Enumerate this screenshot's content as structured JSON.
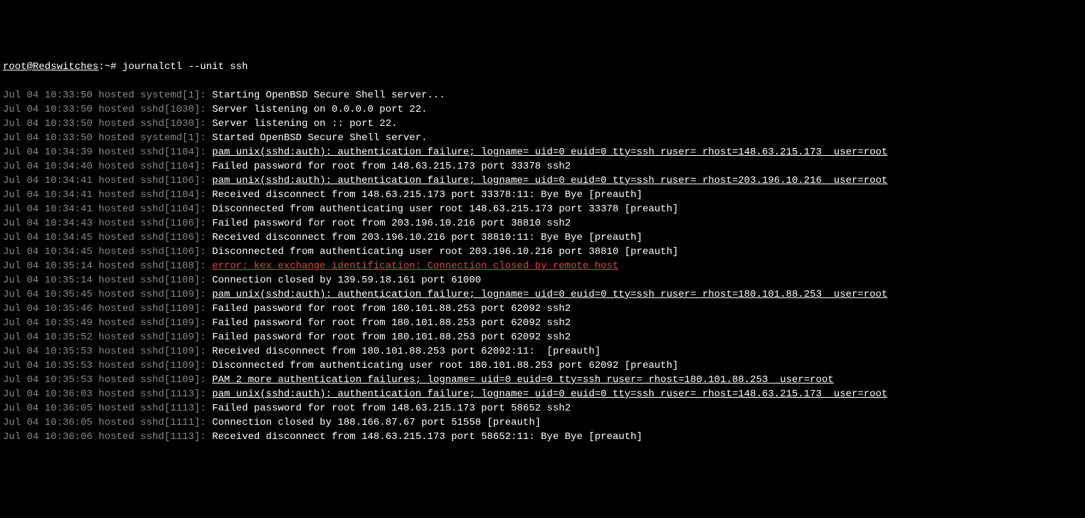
{
  "prompt": {
    "user_host": "root@Redswitches",
    "separator": ":~# ",
    "command": "journalctl --unit ssh"
  },
  "logs": [
    {
      "ts": "Jul 04 10:33:50",
      "host": "hosted",
      "proc": "systemd[1]",
      "msg": "Starting OpenBSD Secure Shell server...",
      "style": "plain"
    },
    {
      "ts": "Jul 04 10:33:50",
      "host": "hosted",
      "proc": "sshd[1030]",
      "msg": "Server listening on 0.0.0.0 port 22.",
      "style": "plain"
    },
    {
      "ts": "Jul 04 10:33:50",
      "host": "hosted",
      "proc": "sshd[1030]",
      "msg": "Server listening on :: port 22.",
      "style": "plain"
    },
    {
      "ts": "Jul 04 10:33:50",
      "host": "hosted",
      "proc": "systemd[1]",
      "msg": "Started OpenBSD Secure Shell server.",
      "style": "plain"
    },
    {
      "ts": "Jul 04 10:34:39",
      "host": "hosted",
      "proc": "sshd[1104]",
      "msg": "pam_unix(sshd:auth): authentication failure; logname= uid=0 euid=0 tty=ssh ruser= rhost=148.63.215.173  user=root",
      "style": "underline"
    },
    {
      "ts": "Jul 04 10:34:40",
      "host": "hosted",
      "proc": "sshd[1104]",
      "msg": "Failed password for root from 148.63.215.173 port 33378 ssh2",
      "style": "plain"
    },
    {
      "ts": "Jul 04 10:34:41",
      "host": "hosted",
      "proc": "sshd[1106]",
      "msg": "pam_unix(sshd:auth): authentication failure; logname= uid=0 euid=0 tty=ssh ruser= rhost=203.196.10.216  user=root",
      "style": "underline"
    },
    {
      "ts": "Jul 04 10:34:41",
      "host": "hosted",
      "proc": "sshd[1104]",
      "msg": "Received disconnect from 148.63.215.173 port 33378:11: Bye Bye [preauth]",
      "style": "plain"
    },
    {
      "ts": "Jul 04 10:34:41",
      "host": "hosted",
      "proc": "sshd[1104]",
      "msg": "Disconnected from authenticating user root 148.63.215.173 port 33378 [preauth]",
      "style": "plain"
    },
    {
      "ts": "Jul 04 10:34:43",
      "host": "hosted",
      "proc": "sshd[1106]",
      "msg": "Failed password for root from 203.196.10.216 port 38810 ssh2",
      "style": "plain"
    },
    {
      "ts": "Jul 04 10:34:45",
      "host": "hosted",
      "proc": "sshd[1106]",
      "msg": "Received disconnect from 203.196.10.216 port 38810:11: Bye Bye [preauth]",
      "style": "plain"
    },
    {
      "ts": "Jul 04 10:34:45",
      "host": "hosted",
      "proc": "sshd[1106]",
      "msg": "Disconnected from authenticating user root 203.196.10.216 port 38810 [preauth]",
      "style": "plain"
    },
    {
      "ts": "Jul 04 10:35:14",
      "host": "hosted",
      "proc": "sshd[1108]",
      "msg": "error: kex_exchange_identification: Connection closed by remote host",
      "style": "red-underline"
    },
    {
      "ts": "Jul 04 10:35:14",
      "host": "hosted",
      "proc": "sshd[1108]",
      "msg": "Connection closed by 139.59.18.161 port 61000",
      "style": "plain"
    },
    {
      "ts": "Jul 04 10:35:45",
      "host": "hosted",
      "proc": "sshd[1109]",
      "msg": "pam_unix(sshd:auth): authentication failure; logname= uid=0 euid=0 tty=ssh ruser= rhost=180.101.88.253  user=root",
      "style": "underline"
    },
    {
      "ts": "Jul 04 10:35:46",
      "host": "hosted",
      "proc": "sshd[1109]",
      "msg": "Failed password for root from 180.101.88.253 port 62092 ssh2",
      "style": "plain"
    },
    {
      "ts": "Jul 04 10:35:49",
      "host": "hosted",
      "proc": "sshd[1109]",
      "msg": "Failed password for root from 180.101.88.253 port 62092 ssh2",
      "style": "plain"
    },
    {
      "ts": "Jul 04 10:35:52",
      "host": "hosted",
      "proc": "sshd[1109]",
      "msg": "Failed password for root from 180.101.88.253 port 62092 ssh2",
      "style": "plain"
    },
    {
      "ts": "Jul 04 10:35:53",
      "host": "hosted",
      "proc": "sshd[1109]",
      "msg": "Received disconnect from 180.101.88.253 port 62092:11:  [preauth]",
      "style": "plain"
    },
    {
      "ts": "Jul 04 10:35:53",
      "host": "hosted",
      "proc": "sshd[1109]",
      "msg": "Disconnected from authenticating user root 180.101.88.253 port 62092 [preauth]",
      "style": "plain"
    },
    {
      "ts": "Jul 04 10:35:53",
      "host": "hosted",
      "proc": "sshd[1109]",
      "msg": "PAM 2 more authentication failures; logname= uid=0 euid=0 tty=ssh ruser= rhost=180.101.88.253  user=root",
      "style": "underline"
    },
    {
      "ts": "Jul 04 10:36:03",
      "host": "hosted",
      "proc": "sshd[1113]",
      "msg": "pam_unix(sshd:auth): authentication failure; logname= uid=0 euid=0 tty=ssh ruser= rhost=148.63.215.173  user=root",
      "style": "underline"
    },
    {
      "ts": "Jul 04 10:36:05",
      "host": "hosted",
      "proc": "sshd[1113]",
      "msg": "Failed password for root from 148.63.215.173 port 58652 ssh2",
      "style": "plain"
    },
    {
      "ts": "Jul 04 10:36:05",
      "host": "hosted",
      "proc": "sshd[1111]",
      "msg": "Connection closed by 188.166.87.67 port 51558 [preauth]",
      "style": "plain"
    },
    {
      "ts": "Jul 04 10:36:06",
      "host": "hosted",
      "proc": "sshd[1113]",
      "msg": "Received disconnect from 148.63.215.173 port 58652:11: Bye Bye [preauth]",
      "style": "plain"
    }
  ]
}
